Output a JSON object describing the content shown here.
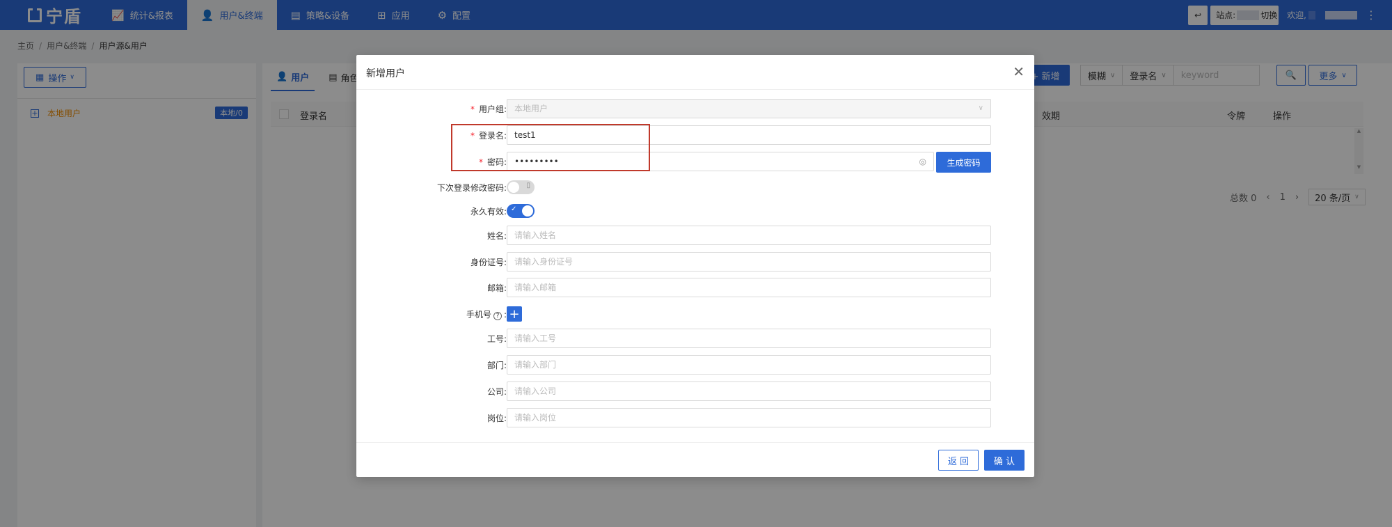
{
  "topbar": {
    "logo": "宁盾",
    "nav": [
      {
        "icon": "chart-line-icon",
        "label": "统计&报表"
      },
      {
        "icon": "user-icon",
        "label": "用户&终端"
      },
      {
        "icon": "policy-device-icon",
        "label": "策略&设备"
      },
      {
        "icon": "apps-grid-icon",
        "label": "应用"
      },
      {
        "icon": "gear-icon",
        "label": "配置"
      }
    ],
    "site_prefix": "站点:",
    "site_suffix": "切换",
    "welcome": "欢迎,"
  },
  "breadcrumb": [
    "主页",
    "用户&终端",
    "用户源&用户"
  ],
  "left_panel": {
    "op_button": "操作",
    "tree_item": "本地用户",
    "tree_badge": "本地/0"
  },
  "right_panel": {
    "tabs": [
      "用户",
      "角色"
    ],
    "add_button": "+ 新增",
    "filter_mode": "模糊",
    "filter_field": "登录名",
    "keyword_placeholder": "keyword",
    "more_button": "更多",
    "columns": {
      "login": "登录名",
      "validity": "效期",
      "token": "令牌",
      "action": "操作"
    },
    "pagination": {
      "total": "总数 0",
      "page": "1",
      "page_size": "20 条/页"
    }
  },
  "modal": {
    "title": "新增用户",
    "fields": {
      "group": {
        "label": "用户组:",
        "value": "本地用户"
      },
      "login": {
        "label": "登录名:",
        "value": "test1"
      },
      "password": {
        "label": "密码:",
        "value": "•••••••••"
      },
      "gen_password": "生成密码",
      "change_pwd_next": {
        "label": "下次登录修改密码:"
      },
      "permanent": {
        "label": "永久有效:"
      },
      "name": {
        "label": "姓名:",
        "placeholder": "请输入姓名"
      },
      "id_card": {
        "label": "身份证号:",
        "placeholder": "请输入身份证号"
      },
      "email": {
        "label": "邮箱:",
        "placeholder": "请输入邮箱"
      },
      "phone": {
        "label": "手机号",
        "suffix": ":"
      },
      "employee_no": {
        "label": "工号:",
        "placeholder": "请输入工号"
      },
      "department": {
        "label": "部门:",
        "placeholder": "请输入部门"
      },
      "company": {
        "label": "公司:",
        "placeholder": "请输入公司"
      },
      "position": {
        "label": "岗位:",
        "placeholder": "请输入岗位"
      }
    },
    "back_button": "返 回",
    "confirm_button": "确 认"
  },
  "colors": {
    "primary": "#2e6bd9",
    "highlight": "#c0392b"
  }
}
